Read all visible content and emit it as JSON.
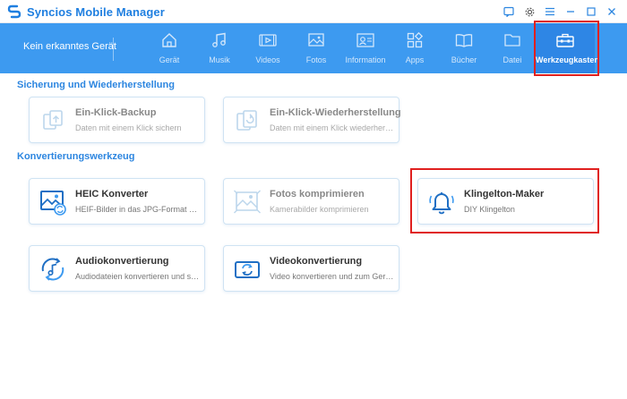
{
  "app": {
    "title": "Syncios Mobile Manager"
  },
  "toolbar": {
    "device_status": "Kein erkanntes Gerät",
    "nav": [
      {
        "label": "Gerät",
        "icon": "home-icon"
      },
      {
        "label": "Musik",
        "icon": "music-icon"
      },
      {
        "label": "Videos",
        "icon": "video-icon"
      },
      {
        "label": "Fotos",
        "icon": "photo-icon"
      },
      {
        "label": "Information",
        "icon": "contact-card-icon"
      },
      {
        "label": "Apps",
        "icon": "apps-icon"
      },
      {
        "label": "Bücher",
        "icon": "book-icon"
      },
      {
        "label": "Datei",
        "icon": "folder-icon"
      },
      {
        "label": "Werkzeugkasten",
        "icon": "toolbox-icon",
        "active": true
      }
    ]
  },
  "sections": {
    "backup": {
      "title": "Sicherung und Wiederherstellung",
      "cards": [
        {
          "title": "Ein-Klick-Backup",
          "subtitle": "Daten mit einem Klick sichern",
          "icon": "backup-icon",
          "enabled": false
        },
        {
          "title": "Ein-Klick-Wiederherstellung",
          "subtitle": "Daten mit einem Klick wiederherst...",
          "icon": "restore-icon",
          "enabled": false
        }
      ]
    },
    "convert": {
      "title": "Konvertierungswerkzeug",
      "cards": [
        {
          "title": "HEIC Konverter",
          "subtitle": "HEIF-Bilder in das JPG-Format kon...",
          "icon": "heic-convert-icon",
          "enabled": true
        },
        {
          "title": "Fotos komprimieren",
          "subtitle": "Kamerabilder komprimieren",
          "icon": "photo-compress-icon",
          "enabled": false
        },
        {
          "title": "Klingelton-Maker",
          "subtitle": "DIY Klingelton",
          "icon": "bell-icon",
          "enabled": true,
          "highlighted": true
        },
        {
          "title": "Audiokonvertierung",
          "subtitle": "Audiodateien konvertieren und sie...",
          "icon": "audio-convert-icon",
          "enabled": true
        },
        {
          "title": "Videokonvertierung",
          "subtitle": "Video konvertieren und zum Gerät...",
          "icon": "video-convert-icon",
          "enabled": true
        }
      ]
    }
  },
  "colors": {
    "accent": "#3d9af0",
    "section_title": "#2d86e0",
    "highlight": "#e0201f"
  }
}
